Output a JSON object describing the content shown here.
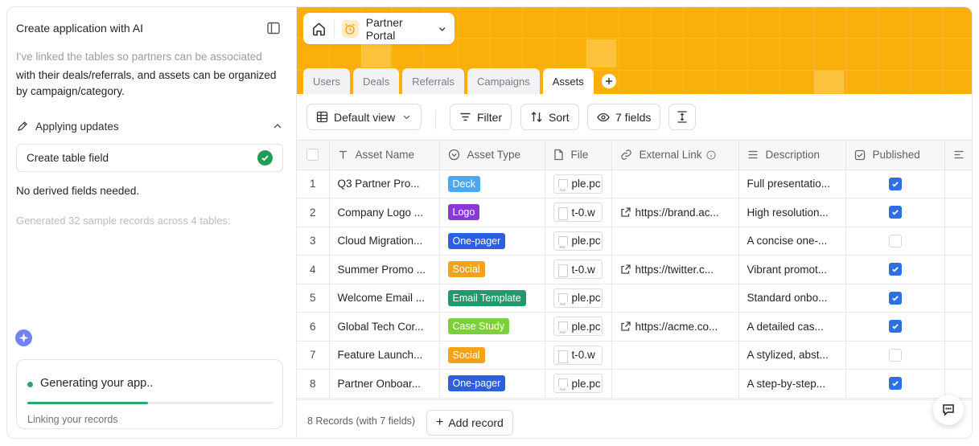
{
  "assistant": {
    "title": "Create application with AI",
    "message_faded": "I've linked the tables so partners can be associated",
    "message": "with their deals/referrals, and assets can be organized by campaign/category.",
    "applying_label": "Applying updates",
    "task_label": "Create table field",
    "no_derived": "No derived fields needed.",
    "generated": "Generated 32 sample records across 4 tables:",
    "progress": {
      "title": "Generating your app..",
      "subtitle": "Linking your records",
      "fraction": 0.49
    }
  },
  "app": {
    "name": "Partner Portal",
    "accent": "#fbaf0b"
  },
  "tabs": [
    {
      "label": "Users",
      "active": false
    },
    {
      "label": "Deals",
      "active": false
    },
    {
      "label": "Referrals",
      "active": false
    },
    {
      "label": "Campaigns",
      "active": false
    },
    {
      "label": "Assets",
      "active": true
    }
  ],
  "toolbar": {
    "view_label": "Default view",
    "filter_label": "Filter",
    "sort_label": "Sort",
    "fields_label": "7 fields"
  },
  "table": {
    "columns": [
      "Asset Name",
      "Asset Type",
      "File",
      "External Link",
      "Description",
      "Published"
    ],
    "rows": [
      {
        "num": "1",
        "name": "Q3 Partner Pro...",
        "type": "Deck",
        "type_color": "#4aa9f0",
        "file": "ple.pc",
        "file_kind": "pdf",
        "link": "",
        "desc": "Full presentatio...",
        "published": true
      },
      {
        "num": "2",
        "name": "Company Logo ...",
        "type": "Logo",
        "type_color": "#8a39d6",
        "file": "t-0.w",
        "file_kind": "img",
        "link": "https://brand.ac...",
        "desc": "High resolution...",
        "published": true
      },
      {
        "num": "3",
        "name": "Cloud Migration...",
        "type": "One-pager",
        "type_color": "#2e5fe0",
        "file": "ple.pc",
        "file_kind": "pdf",
        "link": "",
        "desc": "A concise one-...",
        "published": false
      },
      {
        "num": "4",
        "name": "Summer Promo ...",
        "type": "Social",
        "type_color": "#f5a21b",
        "file": "t-0.w",
        "file_kind": "blank",
        "link": "https://twitter.c...",
        "desc": "Vibrant promot...",
        "published": true
      },
      {
        "num": "5",
        "name": "Welcome Email ...",
        "type": "Email Template",
        "type_color": "#1f9a6a",
        "file": "ple.pc",
        "file_kind": "pdf",
        "link": "",
        "desc": "Standard onbo...",
        "published": true
      },
      {
        "num": "6",
        "name": "Global Tech Cor...",
        "type": "Case Study",
        "type_color": "#7ccf3d",
        "file": "ple.pc",
        "file_kind": "pdf",
        "link": "https://acme.co...",
        "desc": "A detailed cas...",
        "published": true
      },
      {
        "num": "7",
        "name": "Feature Launch...",
        "type": "Social",
        "type_color": "#f5a21b",
        "file": "t-0.w",
        "file_kind": "blank",
        "link": "",
        "desc": "A stylized, abst...",
        "published": false
      },
      {
        "num": "8",
        "name": "Partner Onboar...",
        "type": "One-pager",
        "type_color": "#2e5fe0",
        "file": "ple.pc",
        "file_kind": "pdf",
        "link": "",
        "desc": "A step-by-step...",
        "published": true
      }
    ]
  },
  "footer": {
    "count": "8 Records (with 7 fields)",
    "add_label": "Add record"
  }
}
